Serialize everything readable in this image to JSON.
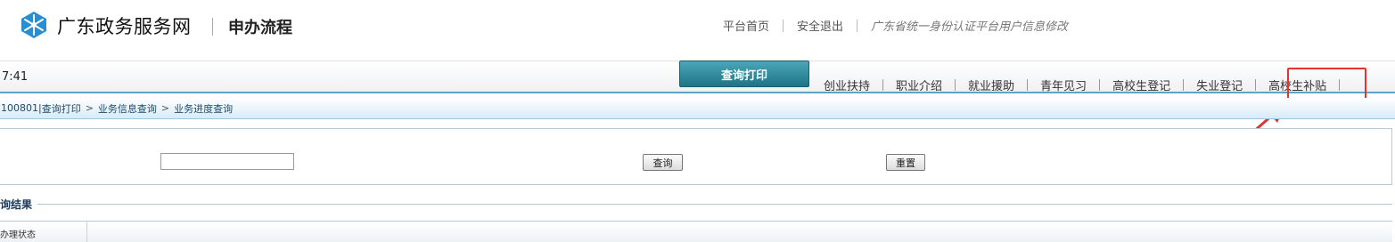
{
  "header": {
    "site_title": "广东政务服务网",
    "page_title": "申办流程",
    "top_links": [
      "平台首页",
      "安全退出"
    ],
    "top_note": "广东省统一身份认证平台用户信息修改"
  },
  "nav": {
    "clock": "7:41",
    "active_tab": "查询打印",
    "items": [
      "创业扶持",
      "职业介绍",
      "就业援助",
      "青年见习",
      "高校生登记",
      "失业登记",
      "高校生补贴"
    ],
    "highlighted_item": "高校生补贴"
  },
  "breadcrumb": {
    "code_prefix": "100801|",
    "items": [
      "查询打印",
      "业务信息查询",
      "业务进度查询"
    ],
    "separator": ">"
  },
  "form": {
    "input_value": "",
    "query_button": "查询",
    "reset_button": "重置"
  },
  "results": {
    "label": "询结果",
    "columns": [
      "办理状态"
    ]
  },
  "colors": {
    "accent": "#1f7487",
    "highlight": "#e5322d",
    "breadcrumb_text": "#1c4a6b"
  }
}
